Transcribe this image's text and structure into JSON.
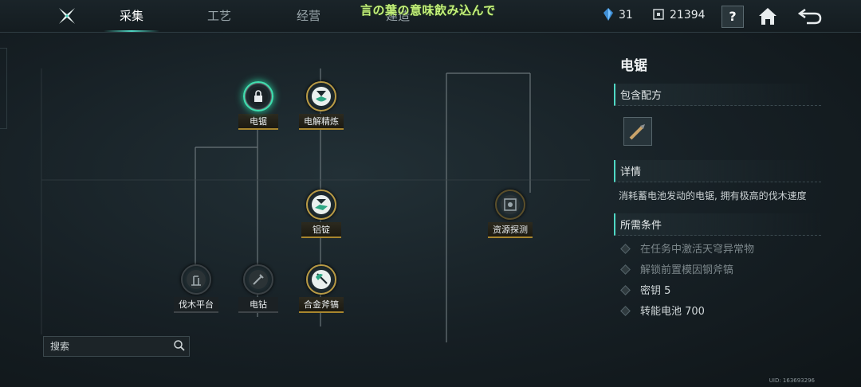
{
  "topbar": {
    "tabs": [
      "采集",
      "工艺",
      "经营",
      "建造"
    ],
    "overlay_title": "言の葉の意味飲み込んで",
    "resource_1": "31",
    "resource_2": "21394",
    "help_label": "?",
    "icons": [
      "logo-icon",
      "crystal-icon",
      "chip-icon",
      "home-icon",
      "back-icon"
    ]
  },
  "tree": {
    "nodes": [
      {
        "label": "电锯",
        "state": "active",
        "icon": "lock-icon"
      },
      {
        "label": "电解精炼",
        "state": "unlocked",
        "icon": "refine-icon"
      },
      {
        "label": "铝锭",
        "state": "unlocked",
        "icon": "ingot-icon"
      },
      {
        "label": "资源探测",
        "state": "dim",
        "icon": "scan-icon"
      },
      {
        "label": "伐木平台",
        "state": "locked",
        "icon": "platform-icon"
      },
      {
        "label": "电钻",
        "state": "locked",
        "icon": "drill-icon"
      },
      {
        "label": "合金斧镐",
        "state": "unlocked",
        "icon": "axe-icon"
      }
    ]
  },
  "search": {
    "placeholder": "搜索"
  },
  "panel": {
    "title": "电锯",
    "recipe_heading": "包含配方",
    "detail_heading": "详情",
    "description": "消耗蓄电池发动的电锯, 拥有极高的伐木速度",
    "requirements_heading": "所需条件",
    "requirements": [
      {
        "text": "在任务中激活天穹异常物",
        "met": false
      },
      {
        "text": "解锁前置模因钢斧镐",
        "met": false
      },
      {
        "text": "密钥 5",
        "met": true
      },
      {
        "text": "转能电池 700",
        "met": true
      }
    ]
  },
  "footer": {
    "uid": "UID: 163693296"
  },
  "colors": {
    "accent": "#4fd8c4",
    "gold": "#b89a45",
    "overlay_text": "#c3f07a"
  }
}
